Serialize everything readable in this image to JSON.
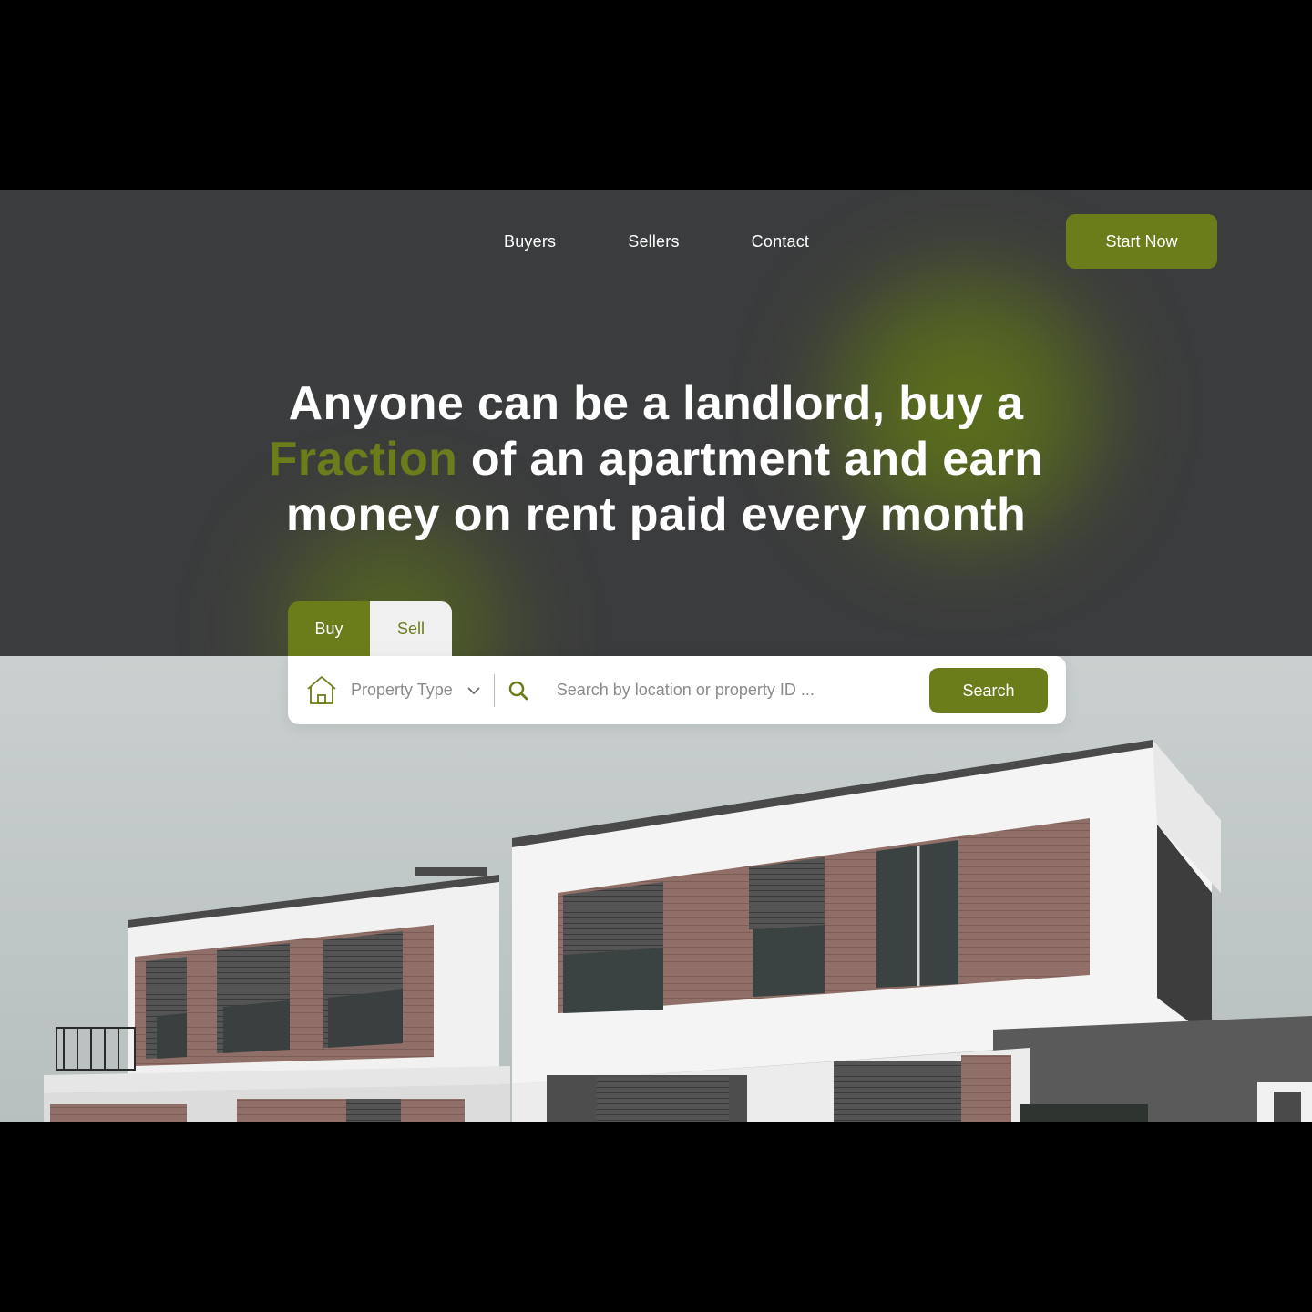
{
  "nav": {
    "items": [
      {
        "label": "Buyers"
      },
      {
        "label": "Sellers"
      },
      {
        "label": "Contact"
      }
    ],
    "cta_label": "Start Now"
  },
  "hero": {
    "line1": "Anyone can be a landlord, buy a",
    "accent_word": "Fraction",
    "line2_rest": " of an apartment and earn",
    "line3": "money on rent paid every month"
  },
  "search": {
    "tabs": [
      {
        "label": "Buy",
        "active": true
      },
      {
        "label": "Sell",
        "active": false
      }
    ],
    "property_type_label": "Property Type",
    "placeholder": "Search by location or property ID ...",
    "button_label": "Search"
  },
  "icons": {
    "house": "house-icon",
    "chevron": "chevron-down-icon",
    "search": "search-icon"
  },
  "colors": {
    "accent": "#6b7d1b",
    "background_dark": "#3b3c3d",
    "text_light": "#ffffff",
    "muted_text": "#8b8b8b"
  }
}
